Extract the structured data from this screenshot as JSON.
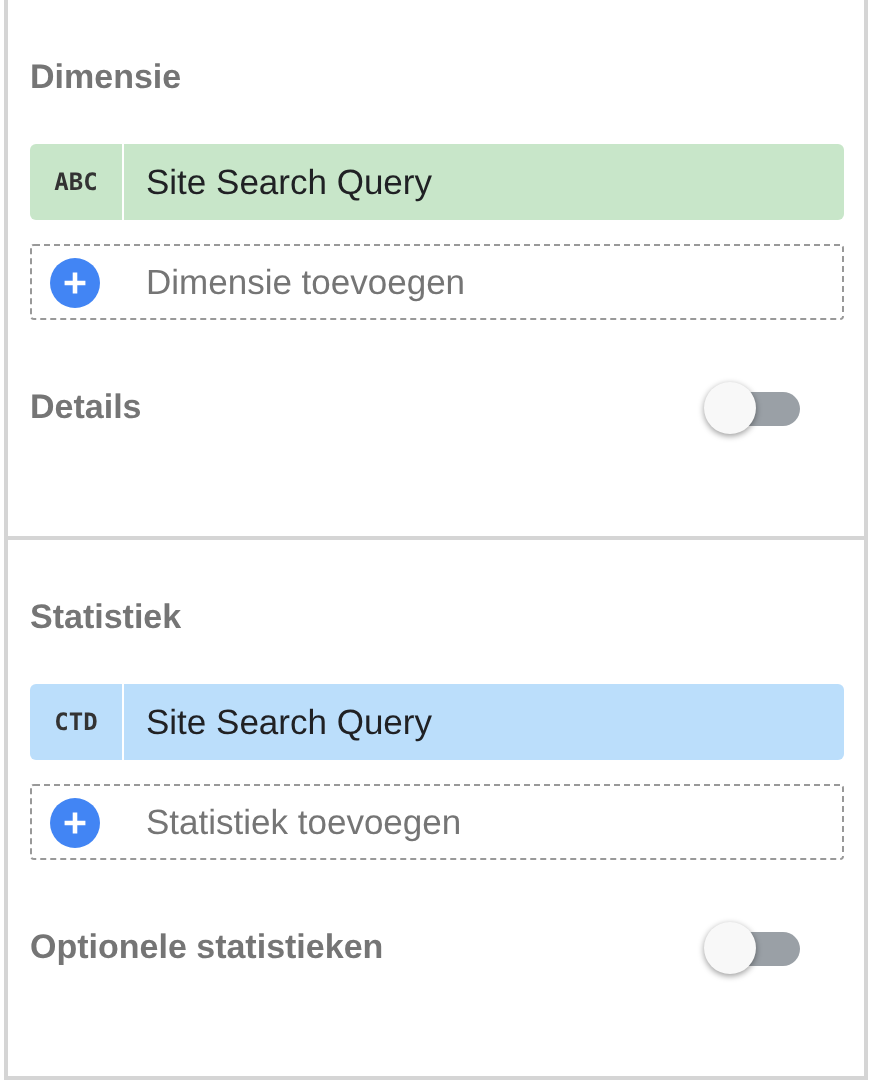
{
  "sections": [
    {
      "heading": "Dimensie",
      "field": {
        "kind": "dimension",
        "type_label": "ABC",
        "name": "Site Search Query"
      },
      "add": {
        "placeholder": "Dimensie toevoegen"
      },
      "toggle": {
        "label": "Details",
        "on": false
      }
    },
    {
      "heading": "Statistiek",
      "field": {
        "kind": "metric",
        "type_label": "CTD",
        "name": "Site Search Query"
      },
      "add": {
        "placeholder": "Statistiek toevoegen"
      },
      "toggle": {
        "label": "Optionele statistieken",
        "on": false
      }
    }
  ]
}
